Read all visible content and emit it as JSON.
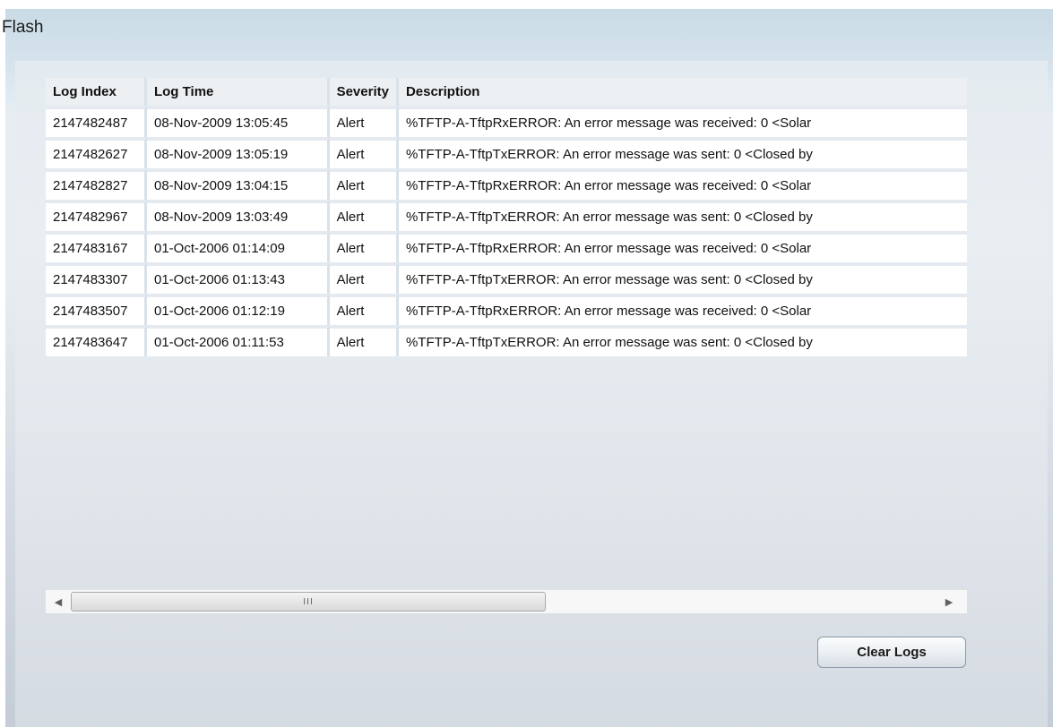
{
  "section": {
    "title": "Flash"
  },
  "log_table": {
    "columns": [
      "Log Index",
      "Log Time",
      "Severity",
      "Description"
    ],
    "rows": [
      {
        "index": "2147482487",
        "time": "08-Nov-2009 13:05:45",
        "severity": "Alert",
        "description": "%TFTP-A-TftpRxERROR: An error message was received: 0 <Solar"
      },
      {
        "index": "2147482627",
        "time": "08-Nov-2009 13:05:19",
        "severity": "Alert",
        "description": "%TFTP-A-TftpTxERROR: An error message was sent: 0 <Closed by"
      },
      {
        "index": "2147482827",
        "time": "08-Nov-2009 13:04:15",
        "severity": "Alert",
        "description": "%TFTP-A-TftpRxERROR: An error message was received: 0 <Solar"
      },
      {
        "index": "2147482967",
        "time": "08-Nov-2009 13:03:49",
        "severity": "Alert",
        "description": "%TFTP-A-TftpTxERROR: An error message was sent: 0 <Closed by"
      },
      {
        "index": "2147483167",
        "time": "01-Oct-2006 01:14:09",
        "severity": "Alert",
        "description": "%TFTP-A-TftpRxERROR: An error message was received: 0 <Solar"
      },
      {
        "index": "2147483307",
        "time": "01-Oct-2006 01:13:43",
        "severity": "Alert",
        "description": "%TFTP-A-TftpTxERROR: An error message was sent: 0 <Closed by"
      },
      {
        "index": "2147483507",
        "time": "01-Oct-2006 01:12:19",
        "severity": "Alert",
        "description": "%TFTP-A-TftpRxERROR: An error message was received: 0 <Solar"
      },
      {
        "index": "2147483647",
        "time": "01-Oct-2006 01:11:53",
        "severity": "Alert",
        "description": "%TFTP-A-TftpTxERROR: An error message was sent: 0 <Closed by"
      }
    ]
  },
  "scrollbar": {
    "left_arrow": "◀",
    "right_arrow": "▶",
    "grip": "III"
  },
  "actions": {
    "clear_logs_label": "Clear Logs"
  },
  "icons": {
    "scroll_left": "scroll-left-arrow-icon",
    "scroll_right": "scroll-right-arrow-icon"
  }
}
